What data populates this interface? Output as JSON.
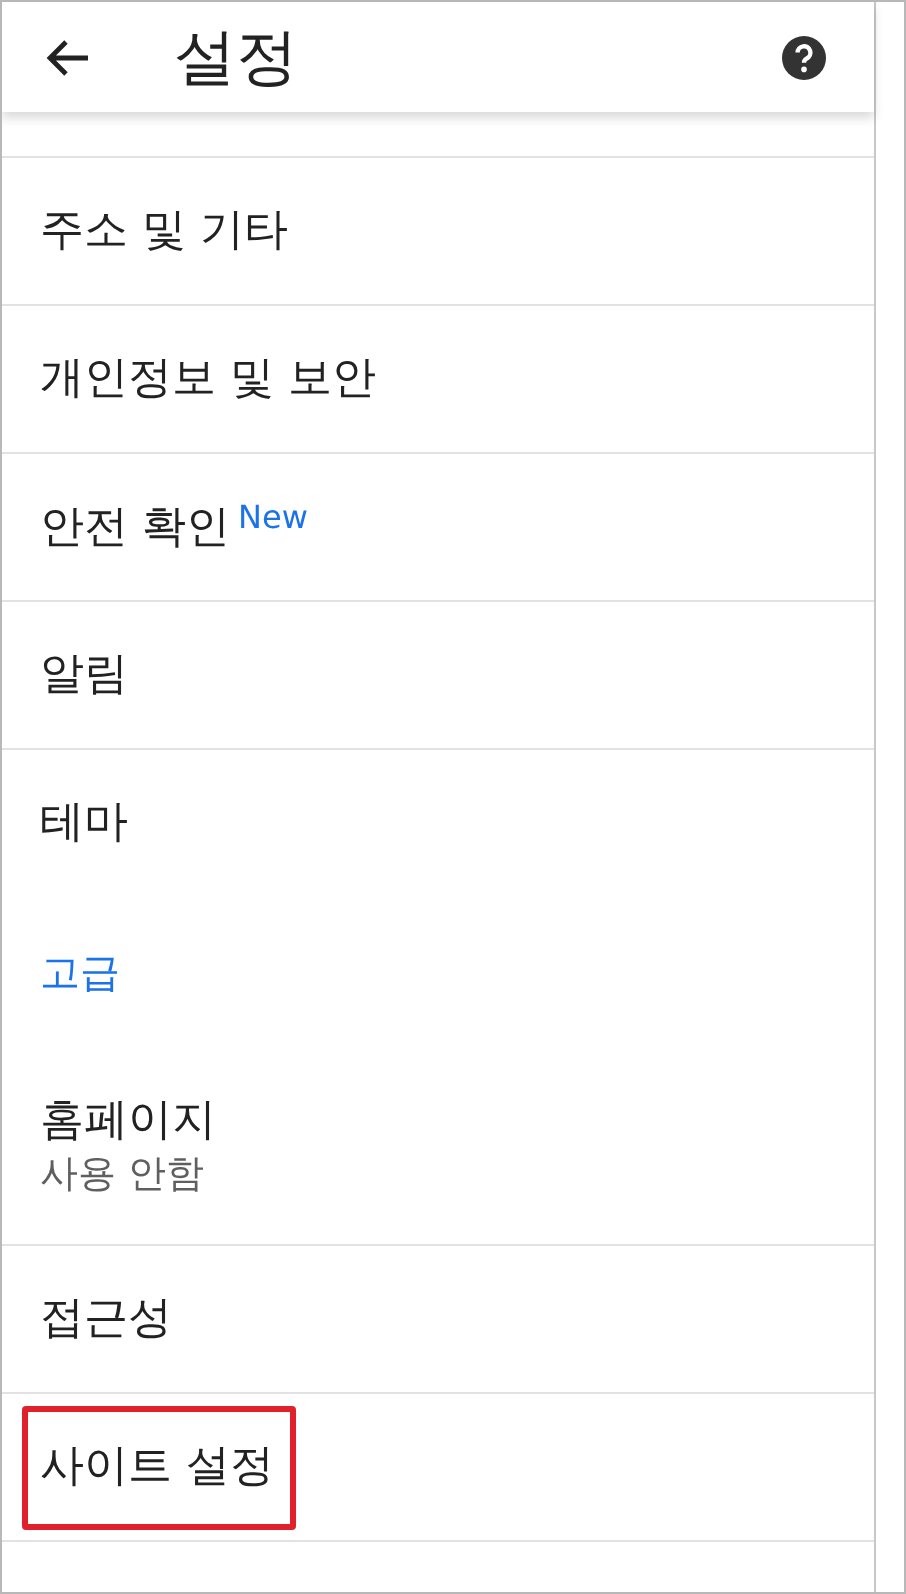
{
  "header": {
    "title": "설정"
  },
  "items": [
    {
      "kind": "item",
      "label": "주소 및 기타",
      "highlighted": false
    },
    {
      "kind": "item",
      "label": "개인정보 및 보안",
      "highlighted": false
    },
    {
      "kind": "item",
      "label": "안전 확인",
      "badge": "New",
      "highlighted": false
    },
    {
      "kind": "item",
      "label": "알림",
      "highlighted": false
    },
    {
      "kind": "item",
      "label": "테마",
      "highlighted": false,
      "divider": false
    },
    {
      "kind": "section",
      "label": "고급"
    },
    {
      "kind": "item",
      "label": "홈페이지",
      "subtitle": "사용 안함",
      "highlighted": false
    },
    {
      "kind": "item",
      "label": "접근성",
      "highlighted": false
    },
    {
      "kind": "item",
      "label": "사이트 설정",
      "highlighted": true
    }
  ]
}
